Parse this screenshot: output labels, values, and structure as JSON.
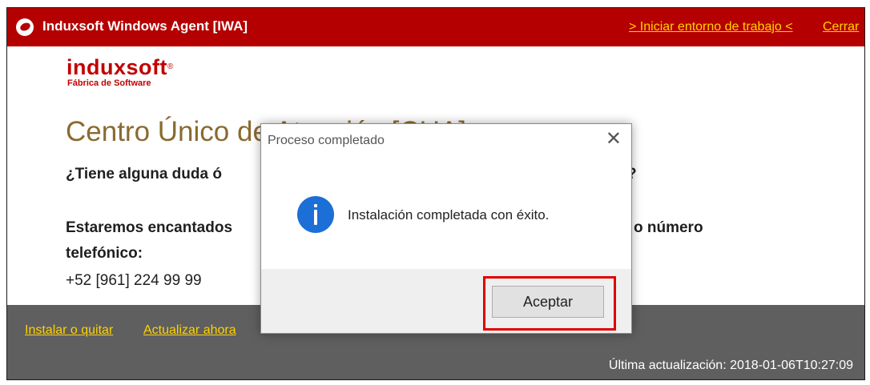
{
  "window": {
    "title": "Induxsoft Windows Agent [IWA]",
    "start_link": "> Iniciar entorno de trabajo <",
    "close_link": "Cerrar"
  },
  "brand": {
    "name": "induxsoft",
    "trademark": "®",
    "tagline": "Fábrica de Software"
  },
  "content": {
    "heading": "Centro Único de Atención [CUA]",
    "question": "¿Tiene alguna duda ó",
    "question_end": "?",
    "contact_line1": "Estaremos encantados",
    "contact_line1_end": "o número",
    "contact_line2": "telefónico:",
    "phone": "+52 [961] 224 99 99"
  },
  "footer": {
    "install_link": "Instalar o quitar",
    "update_link": "Actualizar ahora",
    "last_update": "Última actualización: 2018-01-06T10:27:09"
  },
  "dialog": {
    "title": "Proceso completado",
    "close_glyph": "✕",
    "icon": "info-icon",
    "message": "Instalación completada con éxito.",
    "accept_label": "Aceptar"
  },
  "colors": {
    "titlebar": "#b40000",
    "link": "#ffd200",
    "heading": "#8a6a30",
    "info_icon": "#1b6fd6",
    "highlight": "#e00000"
  }
}
